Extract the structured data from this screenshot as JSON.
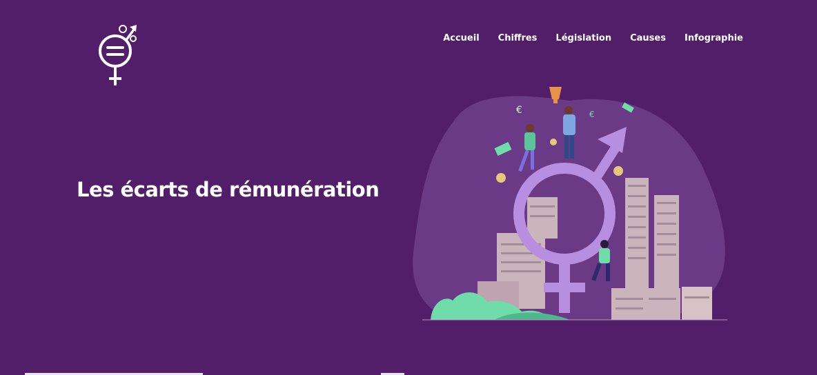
{
  "nav": {
    "items": [
      {
        "label": "Accueil"
      },
      {
        "label": "Chiffres"
      },
      {
        "label": "Législation"
      },
      {
        "label": "Causes"
      },
      {
        "label": "Infographie"
      }
    ]
  },
  "hero": {
    "title": "Les écarts de rémunération"
  },
  "illustration": {
    "currency_symbol": "€"
  },
  "colors": {
    "background": "#521d69",
    "blob": "#6a3a86",
    "symbol": "#b88ee0",
    "building": "#ccb4bc",
    "foliage": "#6fdcaa"
  }
}
